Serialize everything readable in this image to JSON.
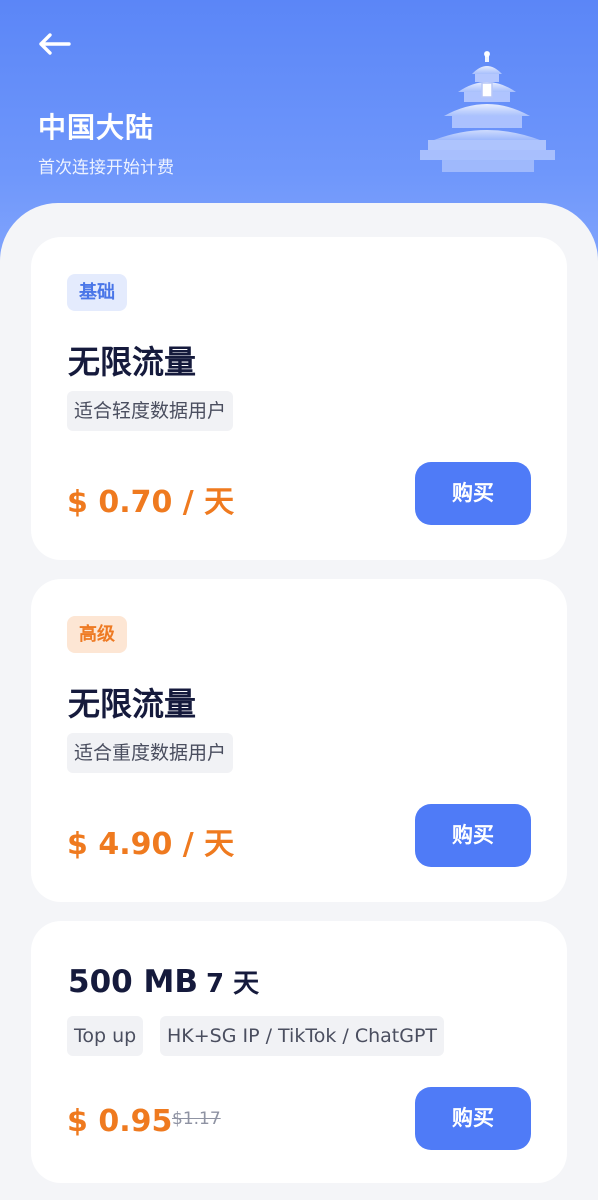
{
  "header": {
    "title": "中国大陆",
    "subtitle": "首次连接开始计费",
    "back_icon": "arrow-left-icon",
    "illustration": "temple-of-heaven-icon"
  },
  "plans": [
    {
      "badge": "基础",
      "title": "无限流量",
      "description": "适合轻度数据用户",
      "price": "$ 0.70 / 天",
      "buy_label": "购买"
    },
    {
      "badge": "高级",
      "title": "无限流量",
      "description": "适合重度数据用户",
      "price": "$ 4.90 / 天",
      "buy_label": "购买"
    }
  ],
  "data_plan": {
    "amount": "500 MB",
    "period": "7 天",
    "tags": [
      "Top up",
      "HK+SG IP / TikTok / ChatGPT"
    ],
    "price": "$ 0.95",
    "original_price": "$1.17",
    "buy_label": "购买"
  },
  "colors": {
    "header_blue": "#5b86f7",
    "button_blue": "#4f7bf7",
    "price_orange": "#ef7a1f",
    "basic_badge_bg": "#e4ebfd",
    "premium_badge_bg": "#fde6d4"
  }
}
